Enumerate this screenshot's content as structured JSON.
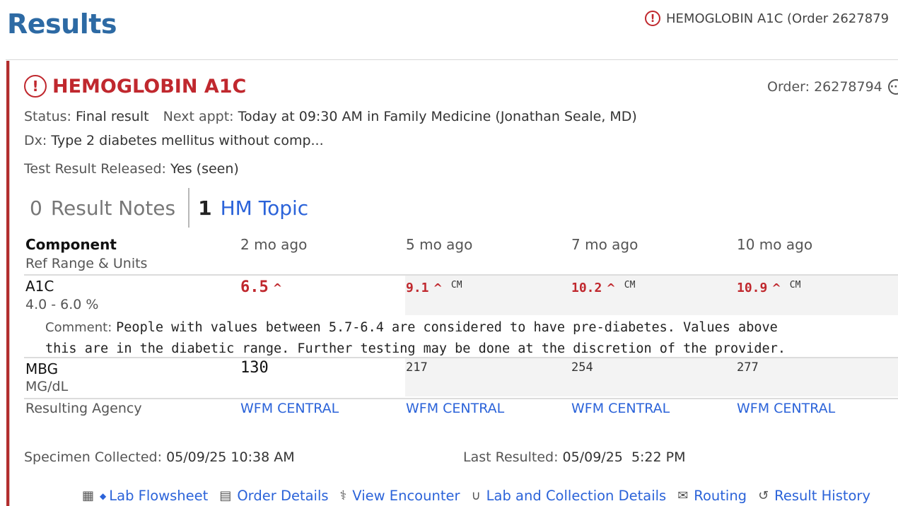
{
  "header": {
    "title": "Results",
    "right_text": "HEMOGLOBIN A1C (Order 2627879"
  },
  "result": {
    "title": "HEMOGLOBIN A1C",
    "order_label": "Order:",
    "order_number": "26278794",
    "status_label": "Status:",
    "status_value": "Final result",
    "next_appt_label": "Next appt:",
    "next_appt_value": "Today at 09:30 AM in Family Medicine (Jonathan Seale, MD)",
    "dx_label": "Dx:",
    "dx_value": "Type 2 diabetes mellitus without comp...",
    "released_label": "Test Result Released:",
    "released_value": "Yes (seen)"
  },
  "tabs": [
    {
      "count": "0",
      "label": "Result Notes"
    },
    {
      "count": "1",
      "label": "HM Topic"
    }
  ],
  "table": {
    "component_header": "Component",
    "ref_header": "Ref Range & Units",
    "columns": [
      "2 mo ago",
      "5 mo ago",
      "7 mo ago",
      "10 mo ago"
    ],
    "rows": [
      {
        "name": "A1C",
        "ref": "4.0 - 6.0 %",
        "values": [
          "6.5",
          "9.1",
          "10.2",
          "10.9"
        ],
        "flags": [
          "^",
          "^",
          "^",
          "^"
        ],
        "notes": [
          "",
          "CM",
          "CM",
          "CM"
        ]
      },
      {
        "name": "MBG",
        "ref": "MG/dL",
        "values": [
          "130",
          "217",
          "254",
          "277"
        ]
      }
    ],
    "comment_label": "Comment:",
    "comment_line1": "People with values between 5.7-6.4 are considered to have pre-diabetes. Values above",
    "comment_line2": "this are in the diabetic range. Further testing may be done at the discretion of the provider.",
    "agency_label": "Resulting Agency",
    "agencies": [
      "WFM CENTRAL",
      "WFM CENTRAL",
      "WFM CENTRAL",
      "WFM CENTRAL"
    ]
  },
  "specimen": {
    "collected_label": "Specimen Collected:",
    "collected_value": "05/09/25 10:38 AM",
    "resulted_label": "Last Resulted:",
    "resulted_value": "05/09/25  5:22 PM"
  },
  "footer_links": [
    {
      "label": "Lab Flowsheet",
      "icon": "flowsheet-icon"
    },
    {
      "label": "Order Details",
      "icon": "order-details-icon"
    },
    {
      "label": "View Encounter",
      "icon": "stethoscope-icon"
    },
    {
      "label": "Lab and Collection Details",
      "icon": "test-tube-icon"
    },
    {
      "label": "Routing",
      "icon": "routing-envelope-icon"
    },
    {
      "label": "Result History",
      "icon": "history-icon"
    }
  ],
  "colors": {
    "title_blue": "#2d6aa4",
    "abnormal_red": "#c0282e",
    "link_blue": "#2b63d9"
  }
}
